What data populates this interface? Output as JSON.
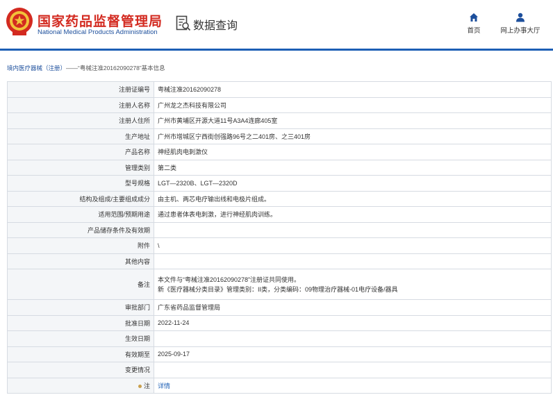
{
  "header": {
    "title_cn": "国家药品监督管理局",
    "title_en": "National Medical Products Administration",
    "section": "数据查询",
    "nav": [
      {
        "label": "首页",
        "icon": "home-icon"
      },
      {
        "label": "网上办事大厅",
        "icon": "user-icon"
      }
    ]
  },
  "breadcrumb": {
    "category": "境内医疗器械（注册）",
    "separator": "——",
    "current": "“粤械注准20162090278”基本信息"
  },
  "colors": {
    "brand_red": "#d32a20",
    "brand_blue": "#1d5fb5",
    "link_blue": "#1d5fb5"
  },
  "rows": [
    {
      "label": "注册证编号",
      "value": "粤械注准20162090278"
    },
    {
      "label": "注册人名称",
      "value": "广州龙之杰科技有限公司"
    },
    {
      "label": "注册人住所",
      "value": "广州市黄埔区开源大道11号A3A4连廊405室"
    },
    {
      "label": "生产地址",
      "value": "广州市增城区宁西街创强路96号之二401房、之三401房"
    },
    {
      "label": "产品名称",
      "value": "神经肌肉电刺激仪"
    },
    {
      "label": "管理类别",
      "value": "第二类"
    },
    {
      "label": "型号规格",
      "value": "LGT—2320B、LGT—2320D"
    },
    {
      "label": "结构及组成/主要组成成分",
      "value": "由主机、两芯电疗输出线和电极片组成。"
    },
    {
      "label": "适用范围/预期用途",
      "value": "通过患者体表电刺激，进行神经肌肉训练。"
    },
    {
      "label": "产品储存条件及有效期",
      "value": ""
    },
    {
      "label": "附件",
      "value": "\\"
    },
    {
      "label": "其他内容",
      "value": ""
    },
    {
      "label": "备注",
      "value_line1": "本文件与“粤械注准20162090278”注册证共同使用。",
      "value_line2": "新《医疗器械分类目录》管理类别：II类，分类编码：09物理治疗器械-01电疗设备/器具"
    },
    {
      "label": "审批部门",
      "value": "广东省药品监督管理局"
    },
    {
      "label": "批准日期",
      "value": "2022-11-24"
    },
    {
      "label": "生效日期",
      "value": ""
    },
    {
      "label": "有效期至",
      "value": "2025-09-17"
    },
    {
      "label": "变更情况",
      "value": ""
    },
    {
      "label": "注",
      "value": "详情"
    }
  ]
}
